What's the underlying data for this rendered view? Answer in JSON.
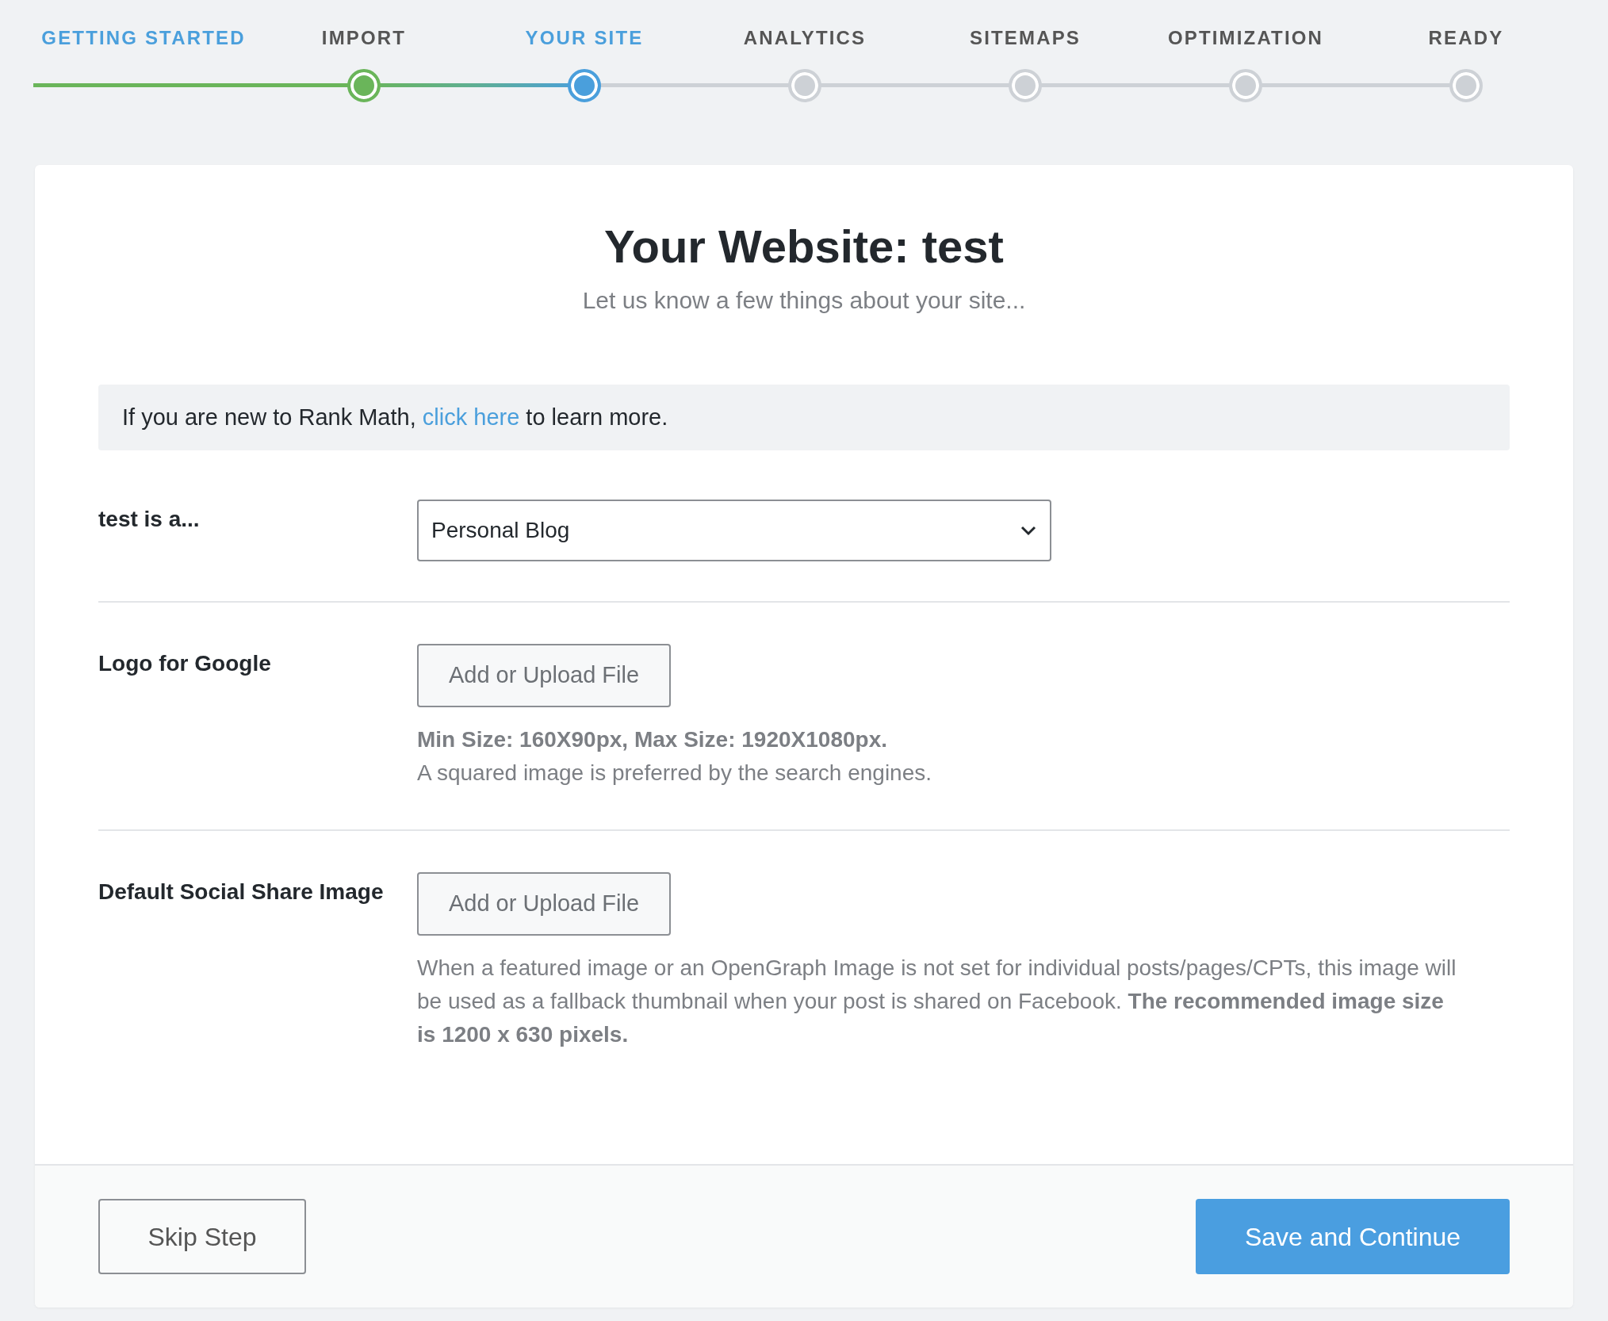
{
  "steps": [
    {
      "label": "GETTING STARTED",
      "kind": "intro"
    },
    {
      "label": "IMPORT",
      "kind": "done"
    },
    {
      "label": "YOUR SITE",
      "kind": "current"
    },
    {
      "label": "ANALYTICS",
      "kind": "todo"
    },
    {
      "label": "SITEMAPS",
      "kind": "todo"
    },
    {
      "label": "OPTIMIZATION",
      "kind": "todo"
    },
    {
      "label": "READY",
      "kind": "todo"
    }
  ],
  "card": {
    "title": "Your Website: test",
    "subtitle": "Let us know a few things about your site...",
    "notice": {
      "before": "If you are new to Rank Math,",
      "link": "click here",
      "after": "to learn more."
    },
    "fields": [
      {
        "kind": "select",
        "label": "test is a...",
        "value": "Personal Blog"
      },
      {
        "kind": "upload",
        "label": "Logo for Google",
        "button": "Add or Upload File",
        "help": [
          {
            "text": "Min Size: 160X90px, Max Size: 1920X1080px.",
            "bold": true
          },
          {
            "text": "A squared image is preferred by the search engines.",
            "bold": false
          }
        ]
      },
      {
        "kind": "upload",
        "label": "Default Social Share Image",
        "button": "Add or Upload File",
        "help": [
          {
            "text": "When a featured image or an OpenGraph Image is not set for individual posts/pages/CPTs, this image will be used as a fallback thumbnail when your post is shared on Facebook. **The recommended image size is 1200 x 630 pixels.**",
            "bold": false
          }
        ]
      }
    ],
    "footer": {
      "skip": "Skip Step",
      "save": "Save and Continue"
    }
  }
}
